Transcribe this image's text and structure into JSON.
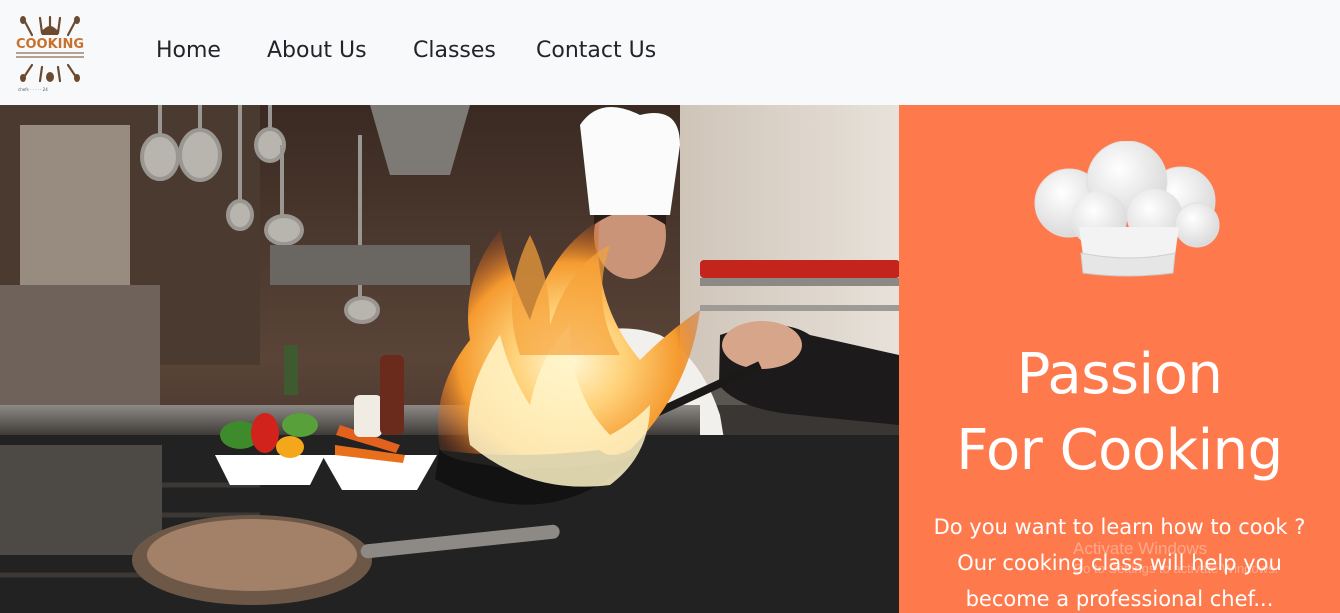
{
  "brand": {
    "logo_text": "COOKING",
    "logo_tagline": "chefs · · · · · 24",
    "logo_accent": "#c8702c"
  },
  "nav": {
    "items": [
      {
        "label": "Home"
      },
      {
        "label": "About Us"
      },
      {
        "label": "Classes"
      },
      {
        "label": "Contact Us"
      }
    ]
  },
  "hero": {
    "image_alt": "chef-flambe-kitchen-photo",
    "panel_color": "#fe7a4d",
    "headline_line1": "Passion",
    "headline_line2": "For Cooking",
    "subtext_lines": [
      "Do you want to learn how to cook ?",
      "Our cooking class will help you",
      "become a professional chef..."
    ]
  },
  "watermark": {
    "line1": "Activate Windows",
    "line2": "Go to Settings to activate Windows."
  }
}
